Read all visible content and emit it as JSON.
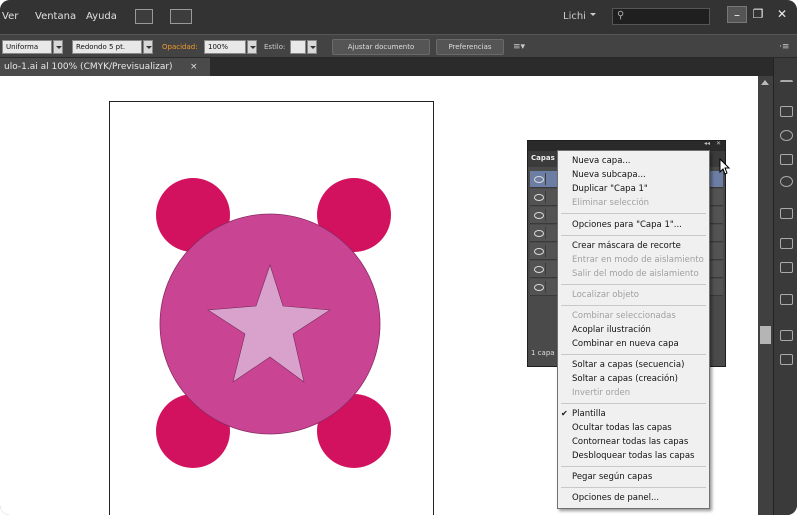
{
  "menubar": {
    "items": [
      "Ver",
      "Ventana",
      "Ayuda"
    ],
    "workspace": "Lichi",
    "search_placeholder": "",
    "minimize": "–",
    "restore": "❐",
    "close": "✕"
  },
  "controlbar": {
    "stroke_profile": "Uniforma",
    "brush": "Redondo 5 pt.",
    "opacity_label": "Opacidad:",
    "opacity_value": "100%",
    "style_label": "Estilo:",
    "fit_document": "Ajustar documento",
    "preferences": "Preferencias"
  },
  "doc_tab": {
    "title": "ulo-1.ai al 100% (CMYK/Previsualizar)",
    "close": "×"
  },
  "artwork": {
    "small_circle_color": "#d2125f",
    "big_circle_color": "#c94593",
    "star_color": "#d8a2cc"
  },
  "layers_panel": {
    "tab": "Capas",
    "footer": "1 capa",
    "collapse": "◂◂",
    "close": "✕"
  },
  "context_menu": {
    "items": [
      {
        "label": "Nueva capa...",
        "disabled": false
      },
      {
        "label": "Nueva subcapa...",
        "disabled": false
      },
      {
        "label": "Duplicar \"Capa 1\"",
        "disabled": false
      },
      {
        "label": "Eliminar selección",
        "disabled": true
      },
      {
        "label": "Opciones para \"Capa 1\"...",
        "disabled": false
      },
      {
        "label": "Crear máscara de recorte",
        "disabled": false
      },
      {
        "label": "Entrar en modo de aislamiento",
        "disabled": true
      },
      {
        "label": "Salir del modo de aislamiento",
        "disabled": true
      },
      {
        "label": "Localizar objeto",
        "disabled": true
      },
      {
        "label": "Combinar seleccionadas",
        "disabled": true
      },
      {
        "label": "Acoplar ilustración",
        "disabled": false
      },
      {
        "label": "Combinar en nueva capa",
        "disabled": false
      },
      {
        "label": "Soltar a capas (secuencia)",
        "disabled": false
      },
      {
        "label": "Soltar a capas (creación)",
        "disabled": false
      },
      {
        "label": "Invertir orden",
        "disabled": true
      },
      {
        "label": "Plantilla",
        "disabled": false,
        "checked": true
      },
      {
        "label": "Ocultar todas las capas",
        "disabled": false
      },
      {
        "label": "Contornear todas las capas",
        "disabled": false
      },
      {
        "label": "Desbloquear todas las capas",
        "disabled": false
      },
      {
        "label": "Pegar según capas",
        "disabled": false
      },
      {
        "label": "Opciones de panel...",
        "disabled": false
      }
    ],
    "check_glyph": "✔"
  }
}
